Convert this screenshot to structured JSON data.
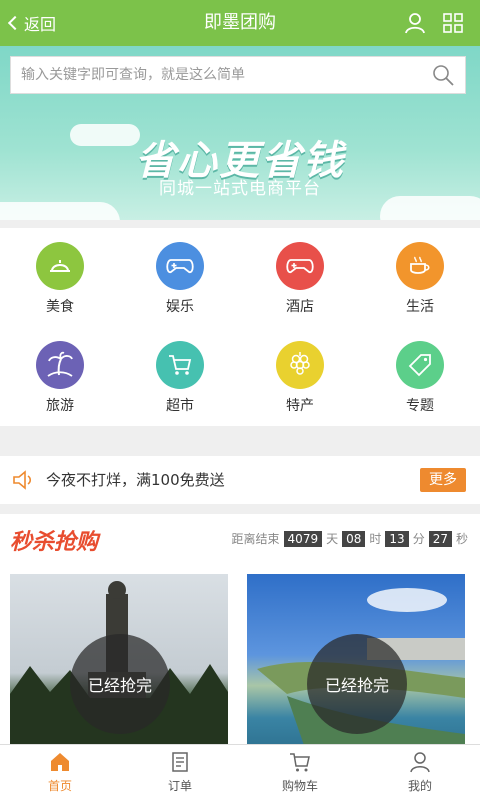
{
  "header": {
    "back_label": "返回",
    "title": "即墨团购",
    "user_icon": "user-icon",
    "grid_icon": "grid-icon"
  },
  "search": {
    "placeholder": "输入关键字即可查询，就是这么简单"
  },
  "banner": {
    "slogan": "省心更省钱",
    "subtitle": "同城一站式电商平台"
  },
  "categories": [
    {
      "label": "美食",
      "icon": "food-icon",
      "color": "#8dc63f"
    },
    {
      "label": "娱乐",
      "icon": "gamepad-icon",
      "color": "#4c8fe0"
    },
    {
      "label": "酒店",
      "icon": "gamepad-icon",
      "color": "#e8504a"
    },
    {
      "label": "生活",
      "icon": "coffee-icon",
      "color": "#f2952c"
    },
    {
      "label": "旅游",
      "icon": "palm-icon",
      "color": "#6c62b5"
    },
    {
      "label": "超市",
      "icon": "cart-icon",
      "color": "#46c1b0"
    },
    {
      "label": "特产",
      "icon": "grapes-icon",
      "color": "#e9d12f"
    },
    {
      "label": "专题",
      "icon": "tag-icon",
      "color": "#5ccf8a"
    }
  ],
  "notice": {
    "text": "今夜不打烊，满100免费送",
    "more_label": "更多"
  },
  "flash_sale": {
    "title": "秒杀抢购",
    "countdown_label": "距离结束",
    "days": "4079",
    "days_unit": "天",
    "hours": "08",
    "hours_unit": "时",
    "minutes": "13",
    "minutes_unit": "分",
    "seconds": "27",
    "seconds_unit": "秒",
    "products": [
      {
        "status": "已经抢完"
      },
      {
        "status": "已经抢完"
      }
    ]
  },
  "tabbar": [
    {
      "label": "首页",
      "icon": "home-icon",
      "active": true
    },
    {
      "label": "订单",
      "icon": "order-icon",
      "active": false
    },
    {
      "label": "购物车",
      "icon": "cart-icon",
      "active": false
    },
    {
      "label": "我的",
      "icon": "user-icon",
      "active": false
    }
  ],
  "colors": {
    "header": "#7cc24a",
    "accent": "#ee8a2f",
    "flash_title": "#e84d2f"
  }
}
